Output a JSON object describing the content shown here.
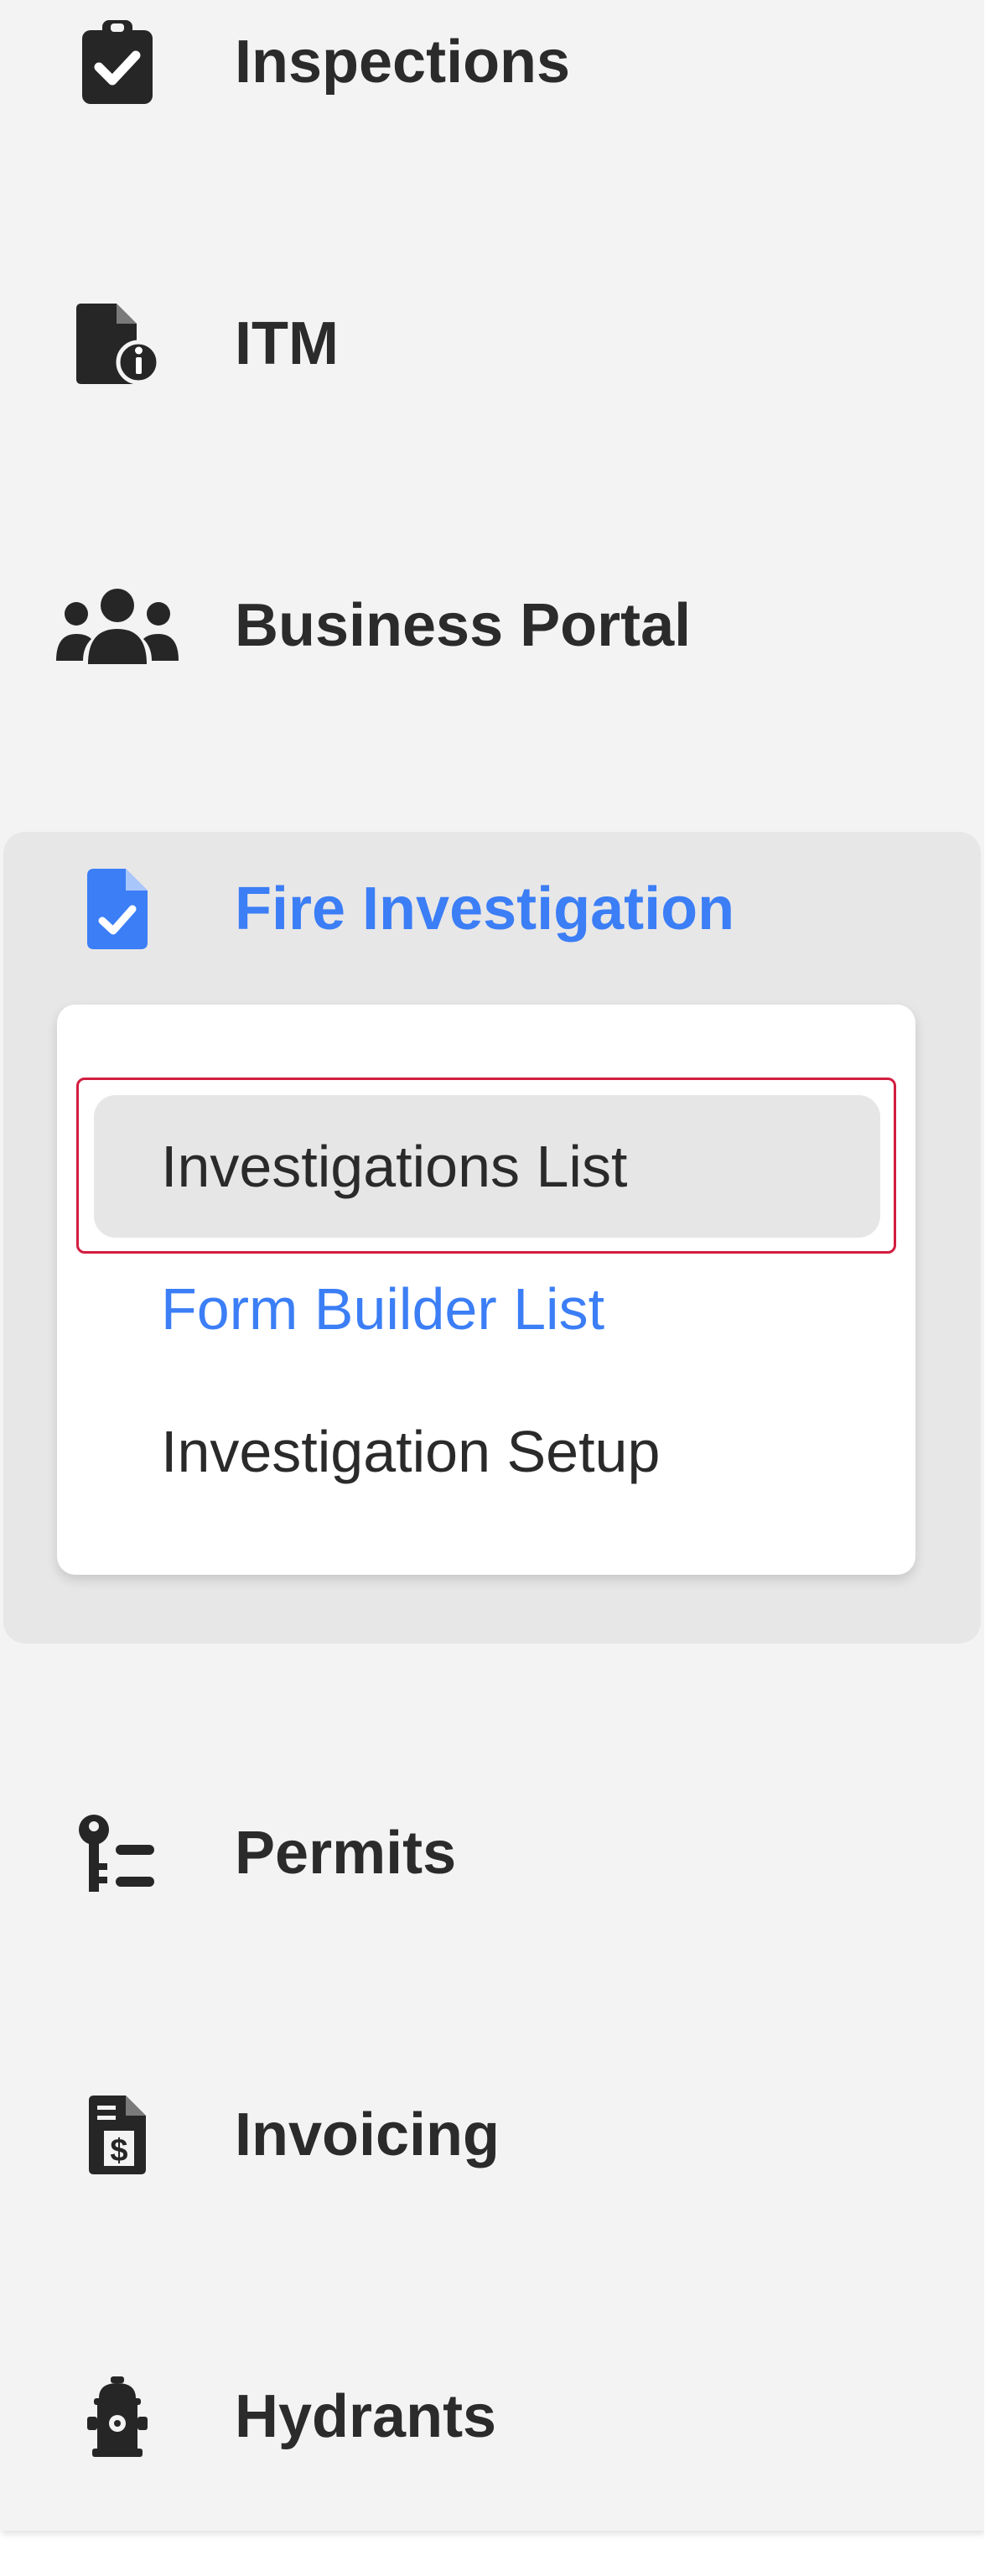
{
  "nav": {
    "inspections": {
      "label": "Inspections",
      "icon": "clipboard-check-icon"
    },
    "itm": {
      "label": "ITM",
      "icon": "file-info-icon"
    },
    "business_portal": {
      "label": "Business Portal",
      "icon": "users-group-icon"
    },
    "fire_investigation": {
      "label": "Fire Investigation",
      "icon": "file-check-icon",
      "expanded": true,
      "submenu": {
        "investigations_list": "Investigations List",
        "form_builder_list": "Form Builder List",
        "investigation_setup": "Investigation Setup"
      }
    },
    "permits": {
      "label": "Permits",
      "icon": "key-list-icon"
    },
    "invoicing": {
      "label": "Invoicing",
      "icon": "file-dollar-icon"
    },
    "hydrants": {
      "label": "Hydrants",
      "icon": "fire-hydrant-icon"
    }
  },
  "colors": {
    "sidebar_bg": "#f3f3f3",
    "active_text": "#3b7ef6",
    "highlight_border": "#d21d3f"
  }
}
